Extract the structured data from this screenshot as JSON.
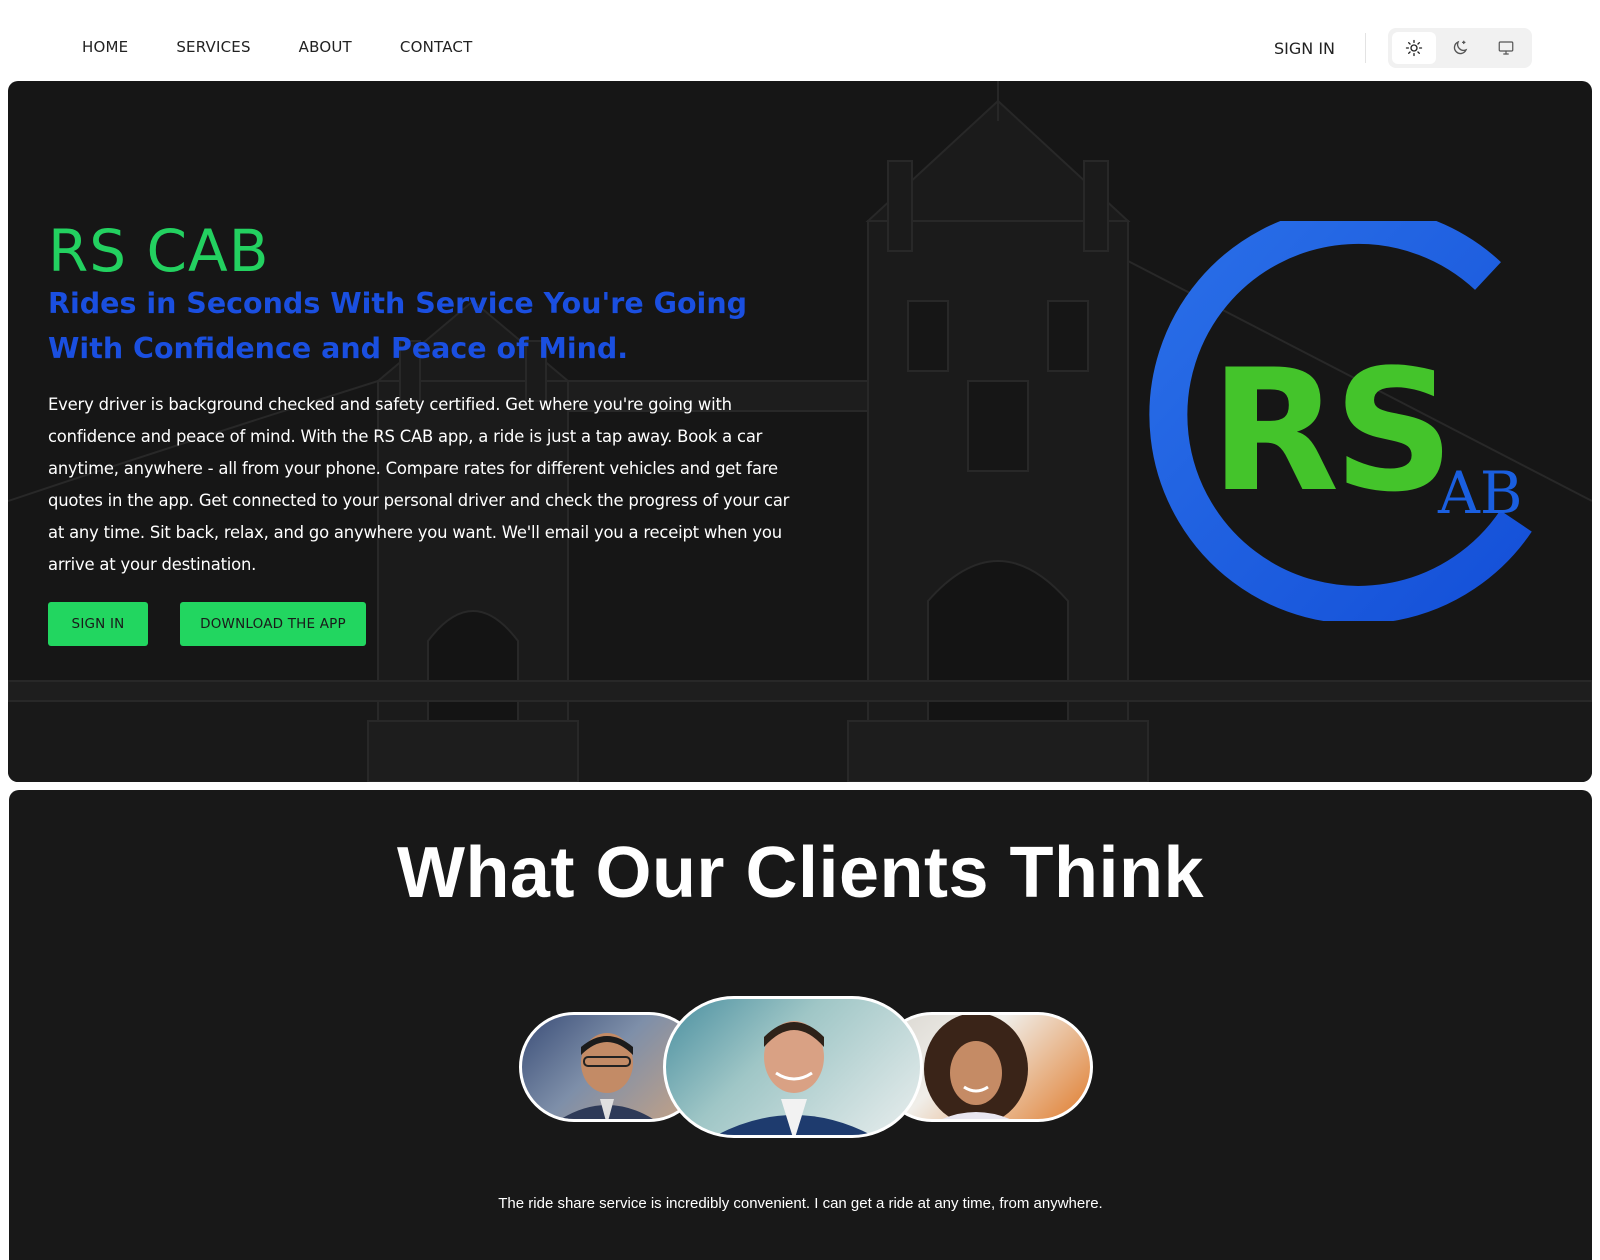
{
  "nav": {
    "links": [
      "HOME",
      "SERVICES",
      "ABOUT",
      "CONTACT"
    ],
    "sign_in": "SIGN IN",
    "theme_icons": [
      "sun-icon",
      "moon-icon",
      "monitor-icon"
    ],
    "active_theme": "light"
  },
  "hero": {
    "title": "RS CAB",
    "subtitle": "Rides in Seconds With Service You're Going With Confidence and Peace of Mind.",
    "description": "Every driver is background checked and safety certified. Get where you're going with confidence and peace of mind. With the RS CAB app, a ride is just a tap away. Book a car anytime, anywhere - all from your phone. Compare rates for different vehicles and get fare quotes in the app. Get connected to your personal driver and check the progress of your car at any time. Sit back, relax, and go anywhere you want. We'll email you a receipt when you arrive at your destination.",
    "sign_in_button": "SIGN IN",
    "download_button": "DOWNLOAD THE APP",
    "logo": {
      "letters": "RS",
      "suffix": "AB",
      "colors": {
        "ring": "#1a5fe0",
        "letters": "#44c42b"
      }
    }
  },
  "testimonials": {
    "title": "What Our Clients Think",
    "avatars": [
      "client-avatar-left",
      "client-avatar-center",
      "client-avatar-right"
    ],
    "quote": "The ride share service is incredibly convenient. I can get a ride at any time, from anywhere."
  },
  "colors": {
    "accent_green": "#22d660",
    "accent_blue": "#1a4fe0",
    "hero_bg": "#161616",
    "section_bg": "#181818"
  }
}
